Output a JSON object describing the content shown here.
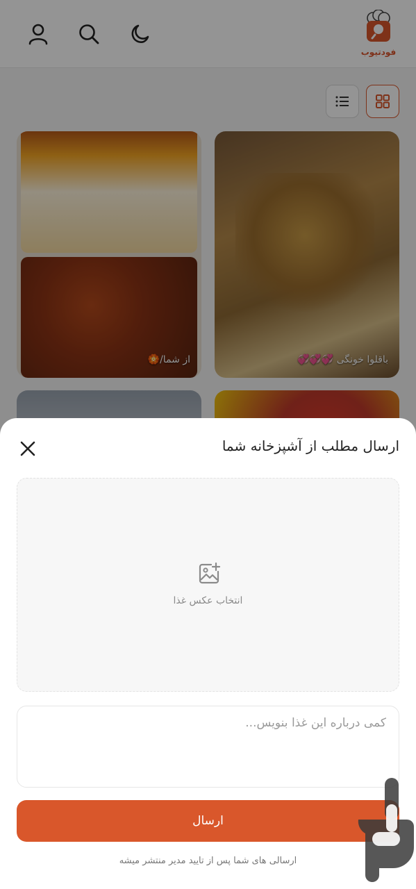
{
  "header": {
    "logo_text": "فودتیوب",
    "icons": [
      "moon-icon",
      "search-icon",
      "user-icon"
    ]
  },
  "colors": {
    "accent": "#d9572b",
    "overlay": "rgba(0,0,0,0.42)"
  },
  "feed": {
    "cards": [
      {
        "label": "باقلوا خونگی 💞💞💞"
      },
      {
        "label": "از شما/🏵️"
      }
    ]
  },
  "sheet": {
    "title": "ارسال مطلب از آشپزخانه شما",
    "upload_label": "انتخاب عکس غذا",
    "textarea_placeholder": "کمی درباره این غذا بنویس...",
    "submit_label": "ارسال",
    "note": "ارسالی های شما پس از تایید مدیر منتشر میشه"
  }
}
